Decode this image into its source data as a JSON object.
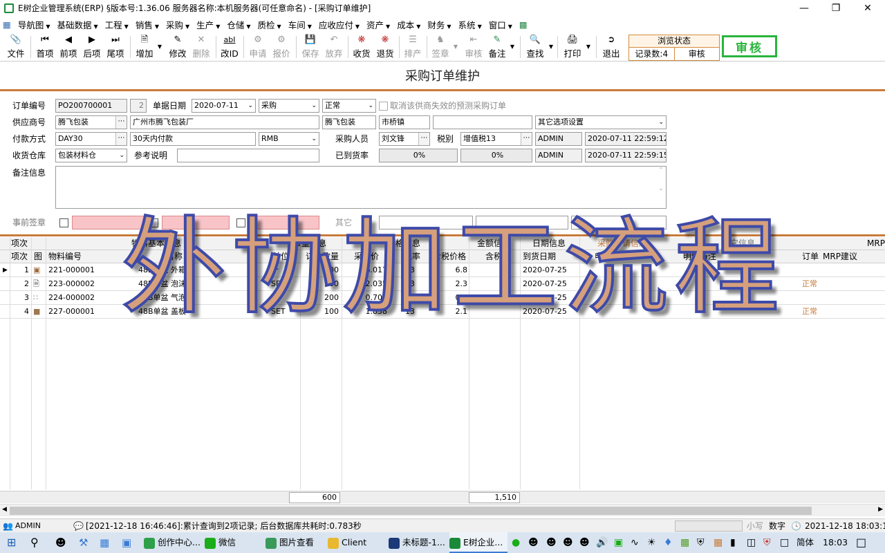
{
  "window": {
    "title": "E树企业管理系统(ERP) §版本号:1.36.06  服务器名称:本机服务器(可任意命名) - [采购订单维护]",
    "min": "—",
    "max": "❐",
    "close": "✕"
  },
  "menu": [
    "导航图",
    "基础数据",
    "工程",
    "销售",
    "采购",
    "生产",
    "仓储",
    "质检",
    "车间",
    "应收应付",
    "资产",
    "成本",
    "财务",
    "系统",
    "窗口"
  ],
  "toolbar": {
    "file": "文件",
    "first": "首项",
    "prev": "前项",
    "next": "后项",
    "last": "尾项",
    "add": "增加",
    "edit": "修改",
    "delete": "删除",
    "change_id": "改ID",
    "apply": "申请",
    "quote": "报价",
    "save": "保存",
    "discard": "放弃",
    "receive": "收货",
    "return": "退货",
    "schedule": "排产",
    "sign": "签章",
    "audit_btn": "审核",
    "remark": "备注",
    "find": "查找",
    "print": "打印",
    "exit": "退出"
  },
  "browse": {
    "state": "浏览状态",
    "records": "记录数:4",
    "audit": "审核"
  },
  "audit_stamp": "审核",
  "page_title": "采购订单维护",
  "form": {
    "order_no_label": "订单编号",
    "order_no": "PO200700001",
    "order_seq": "2",
    "date_label": "单据日期",
    "date": "2020-07-11",
    "type": "采购",
    "status": "正常",
    "cancel_forecast": "取消该供商失效的预测采购订单",
    "supplier_label": "供应商号",
    "supplier_code": "腾飞包装",
    "supplier_name": "广州市腾飞包装厂",
    "supplier_short": "腾飞包装",
    "town": "市桥镇",
    "other_opts": "其它选项设置",
    "pay_label": "付款方式",
    "pay_code": "DAY30",
    "pay_desc": "30天内付款",
    "currency": "RMB",
    "buyer_label": "采购人员",
    "buyer": "刘文锋",
    "tax_label": "税别",
    "tax": "增值税13",
    "creator": "ADMIN",
    "created": "2020-07-11 22:59:12",
    "wh_label": "收货仓库",
    "warehouse": "包装材料仓",
    "ref_label": "参考说明",
    "arrival_label": "已到货率",
    "arrival1": "0%",
    "arrival2": "0%",
    "modifier": "ADMIN",
    "modified": "2020-07-11 22:59:15",
    "memo_label": "备注信息",
    "presign_label": "事前签章",
    "other_label": "其它"
  },
  "grid": {
    "group_headers": {
      "item": "项次",
      "basic": "物料基本信息",
      "qty": "数量信息",
      "price": "价格信息",
      "amount": "金额信息",
      "date": "日期信息",
      "apply": "采购申请信息",
      "other": "其它信息",
      "mrp": "MRP信"
    },
    "columns": {
      "item": "项次",
      "img": "图",
      "code": "物料编号",
      "name": "名称",
      "unit": "单位",
      "qty": "订单数量",
      "price": "采购价",
      "tax": "税率",
      "taxprice": "含税价格",
      "taxamt": "含税金",
      "duedate": "到货日期",
      "applyno": "申请单",
      "detail": "明细备注",
      "order": "订单",
      "mrp": "MRP建议"
    },
    "rows": [
      {
        "item": "1",
        "code": "221-000001",
        "name": "48B单盆 外箱",
        "unit": "个",
        "qty": "100",
        "price": "6.017",
        "tax": "13",
        "taxprice": "6.8",
        "due": "2020-07-25",
        "status": ""
      },
      {
        "item": "2",
        "code": "223-000002",
        "name": "48B单盆 泡沫",
        "unit": "SET",
        "qty": "200",
        "price": "2.035",
        "tax": "13",
        "taxprice": "2.3",
        "due": "2020-07-25",
        "status": "正常"
      },
      {
        "item": "3",
        "code": "224-000002",
        "name": "48B单盆 气泡袋",
        "unit": "个",
        "qty": "200",
        "price": "0.708",
        "tax": "13",
        "taxprice": "0.8",
        "due": "2020-07-25",
        "status": ""
      },
      {
        "item": "4",
        "code": "227-000001",
        "name": "48B单盆 盖板",
        "unit": "SET",
        "qty": "100",
        "price": "1.858",
        "tax": "13",
        "taxprice": "2.1",
        "due": "2020-07-25",
        "status": "正常"
      }
    ],
    "sum_qty": "600",
    "sum_amount": "1,510"
  },
  "status": {
    "user": "ADMIN",
    "message": "[2021-12-18 16:46:46]:累计查询到2项记录; 后台数据库共耗时:0.783秒",
    "lowercase": "小写",
    "numpad": "数字",
    "datetime": "2021-12-18 18:03:18"
  },
  "taskbar": {
    "items": [
      "创作中心...",
      "微信",
      "图片查看",
      "Client",
      "未标题-1...",
      "E树企业..."
    ],
    "ime": "简体",
    "time": "18:03"
  },
  "overlay_text": "外协加工流程",
  "colors": {
    "accent": "#c87a3a",
    "audit_green": "#28b43c",
    "overlay_fill": "#d6a07c",
    "overlay_stroke": "#3e4aa8"
  }
}
